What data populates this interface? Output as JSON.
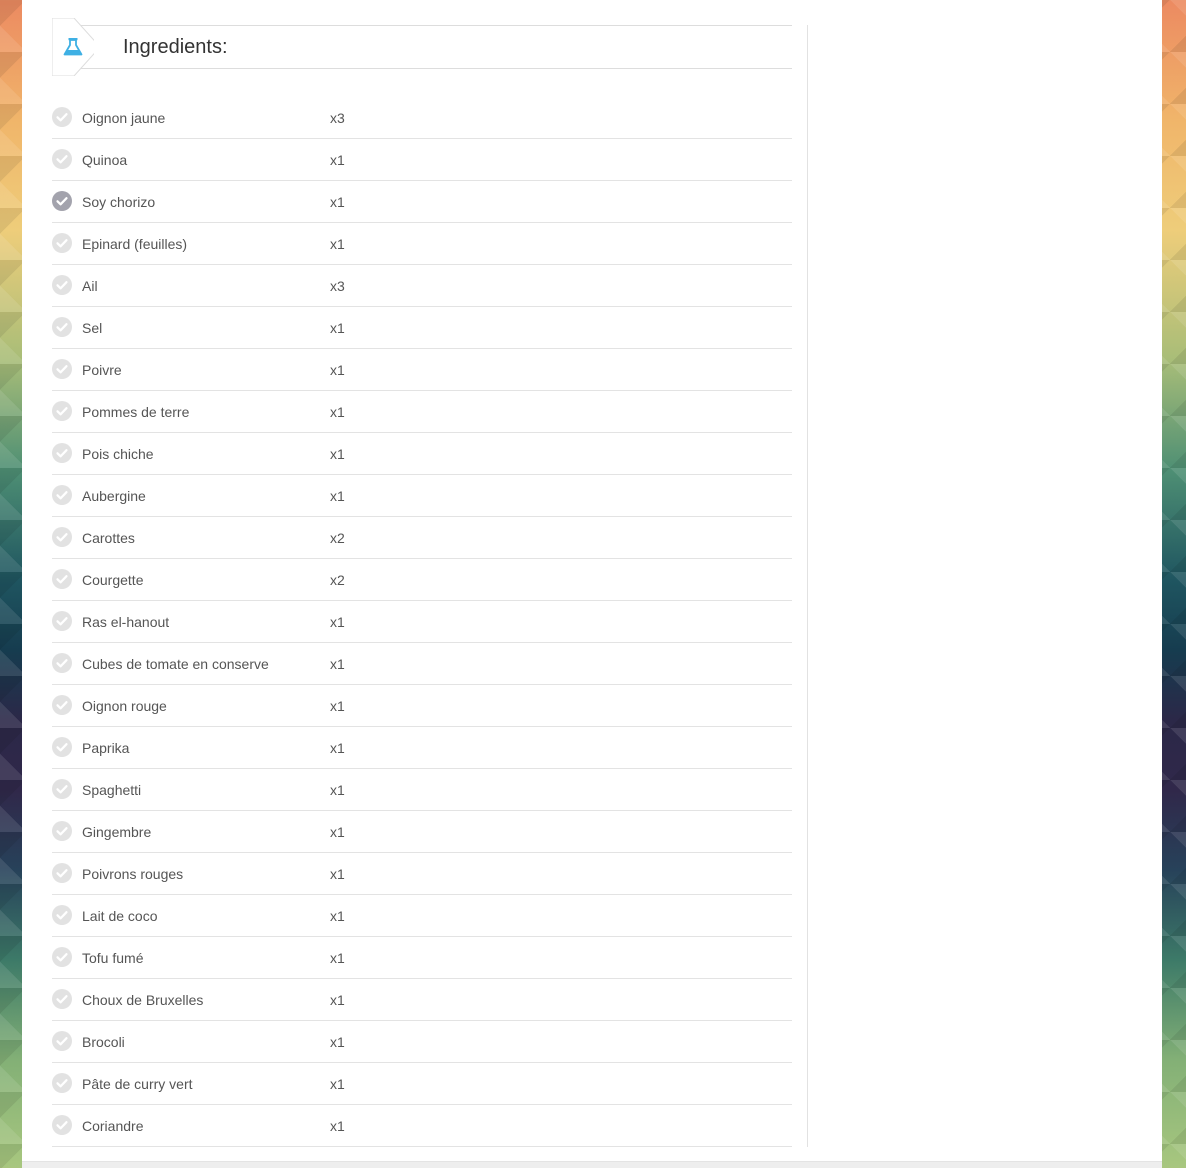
{
  "header": {
    "title": "Ingredients:",
    "icon": "flask-icon",
    "icon_color": "#3fb0e4"
  },
  "colors": {
    "check_unchecked": "#e2e2e2",
    "check_checked": "#a3a3ad"
  },
  "ingredients": [
    {
      "name": "Oignon jaune",
      "qty": "x3",
      "checked": false
    },
    {
      "name": "Quinoa",
      "qty": "x1",
      "checked": false
    },
    {
      "name": "Soy chorizo",
      "qty": "x1",
      "checked": true
    },
    {
      "name": "Epinard (feuilles)",
      "qty": "x1",
      "checked": false
    },
    {
      "name": "Ail",
      "qty": "x3",
      "checked": false
    },
    {
      "name": "Sel",
      "qty": "x1",
      "checked": false
    },
    {
      "name": "Poivre",
      "qty": "x1",
      "checked": false
    },
    {
      "name": "Pommes de terre",
      "qty": "x1",
      "checked": false
    },
    {
      "name": "Pois chiche",
      "qty": "x1",
      "checked": false
    },
    {
      "name": "Aubergine",
      "qty": "x1",
      "checked": false
    },
    {
      "name": "Carottes",
      "qty": "x2",
      "checked": false
    },
    {
      "name": "Courgette",
      "qty": "x2",
      "checked": false
    },
    {
      "name": "Ras el-hanout",
      "qty": "x1",
      "checked": false
    },
    {
      "name": "Cubes de tomate en conserve",
      "qty": "x1",
      "checked": false
    },
    {
      "name": "Oignon rouge",
      "qty": "x1",
      "checked": false
    },
    {
      "name": "Paprika",
      "qty": "x1",
      "checked": false
    },
    {
      "name": "Spaghetti",
      "qty": "x1",
      "checked": false
    },
    {
      "name": "Gingembre",
      "qty": "x1",
      "checked": false
    },
    {
      "name": "Poivrons rouges",
      "qty": "x1",
      "checked": false
    },
    {
      "name": "Lait de coco",
      "qty": "x1",
      "checked": false
    },
    {
      "name": "Tofu fumé",
      "qty": "x1",
      "checked": false
    },
    {
      "name": "Choux de Bruxelles",
      "qty": "x1",
      "checked": false
    },
    {
      "name": "Brocoli",
      "qty": "x1",
      "checked": false
    },
    {
      "name": "Pâte de curry vert",
      "qty": "x1",
      "checked": false
    },
    {
      "name": "Coriandre",
      "qty": "x1",
      "checked": false
    }
  ]
}
